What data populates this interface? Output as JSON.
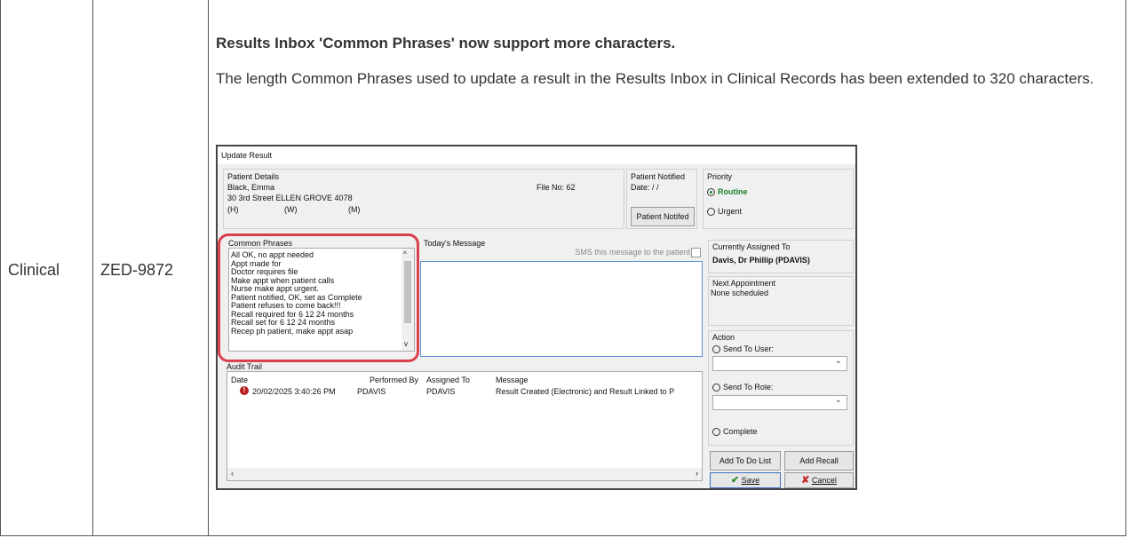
{
  "row": {
    "category": "Clinical",
    "ticket": "ZED-9872",
    "title": "Results Inbox 'Common Phrases' now support more characters.",
    "description": "The length Common Phrases used to update a result in the Results Inbox in Clinical Records has been extended to 320 characters."
  },
  "dialog": {
    "window_title": "Update Result",
    "patient": {
      "group_label": "Patient Details",
      "name": "Black, Emma",
      "address": "30 3rd Street  ELLEN GROVE  4078",
      "phone_h": "(H)",
      "phone_w": "(W)",
      "phone_m": "(M)",
      "file_no": "File No: 62"
    },
    "notified": {
      "group_label": "Patient Notified",
      "date": "Date:  / /",
      "button": "Patient Notifed"
    },
    "priority": {
      "group_label": "Priority",
      "routine": "Routine",
      "urgent": "Urgent",
      "selected_color": "#1a7f2e"
    },
    "common_phrases": {
      "group_label": "Common Phrases",
      "items": [
        "All OK, no appt needed",
        "Appt made for",
        "Doctor requires file",
        "Make appt when patient calls",
        "Nurse make appt urgent.",
        "Patient notified, OK, set as Complete",
        "Patient refuses to come back!!!",
        "Recall required for 6  12  24  months",
        "Recall set for 6 12 24 months",
        "Recep ph patient, make appt asap"
      ],
      "highlight_color": "#d9414e"
    },
    "message": {
      "group_label": "Today's Message",
      "sms_label": "SMS this message to the patient"
    },
    "assigned": {
      "group_label": "Currently Assigned To",
      "value": "Davis, Dr Phillip (PDAVIS)"
    },
    "next_appt": {
      "group_label": "Next Appointment",
      "value": "None scheduled"
    },
    "action": {
      "group_label": "Action",
      "send_user": "Send To User:",
      "send_role": "Send To Role:",
      "complete": "Complete"
    },
    "audit": {
      "group_label": "Audit Trail",
      "columns": [
        "Date",
        "Performed By",
        "Assigned To",
        "Message"
      ],
      "row": {
        "date": "20/02/2025 3:40:26 PM",
        "by": "PDAVIS",
        "to": "PDAVIS",
        "message": "Result Created (Electronic) and Result Linked to P"
      }
    },
    "buttons": {
      "todo": "Add To Do List",
      "recall": "Add Recall",
      "save": "Save",
      "cancel": "Cancel"
    }
  }
}
